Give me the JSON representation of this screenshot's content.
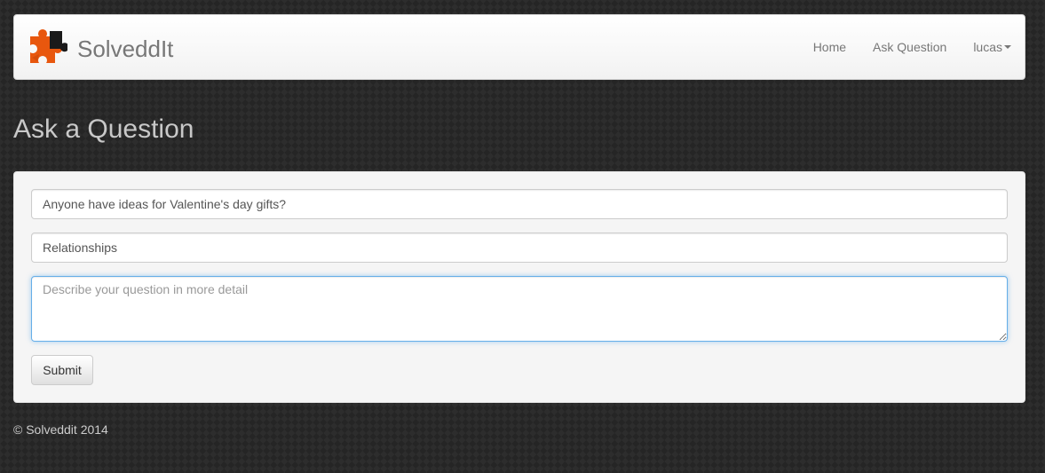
{
  "navbar": {
    "brand": "SolveddIt",
    "logo_icon": "puzzle-piece-icon",
    "items": [
      {
        "label": "Home"
      },
      {
        "label": "Ask Question"
      },
      {
        "label": "lucas"
      }
    ]
  },
  "page": {
    "title": "Ask a Question"
  },
  "form": {
    "question_title_value": "Anyone have ideas for Valentine's day gifts?",
    "category_value": "Relationships",
    "detail_value": "",
    "detail_placeholder": "Describe your question in more detail",
    "submit_label": "Submit"
  },
  "footer": {
    "text": "© Solveddit 2014"
  },
  "colors": {
    "background": "#252525",
    "logo_orange": "#e8570e",
    "logo_dark": "#1a1a1a",
    "focus_border": "#66afe9"
  }
}
